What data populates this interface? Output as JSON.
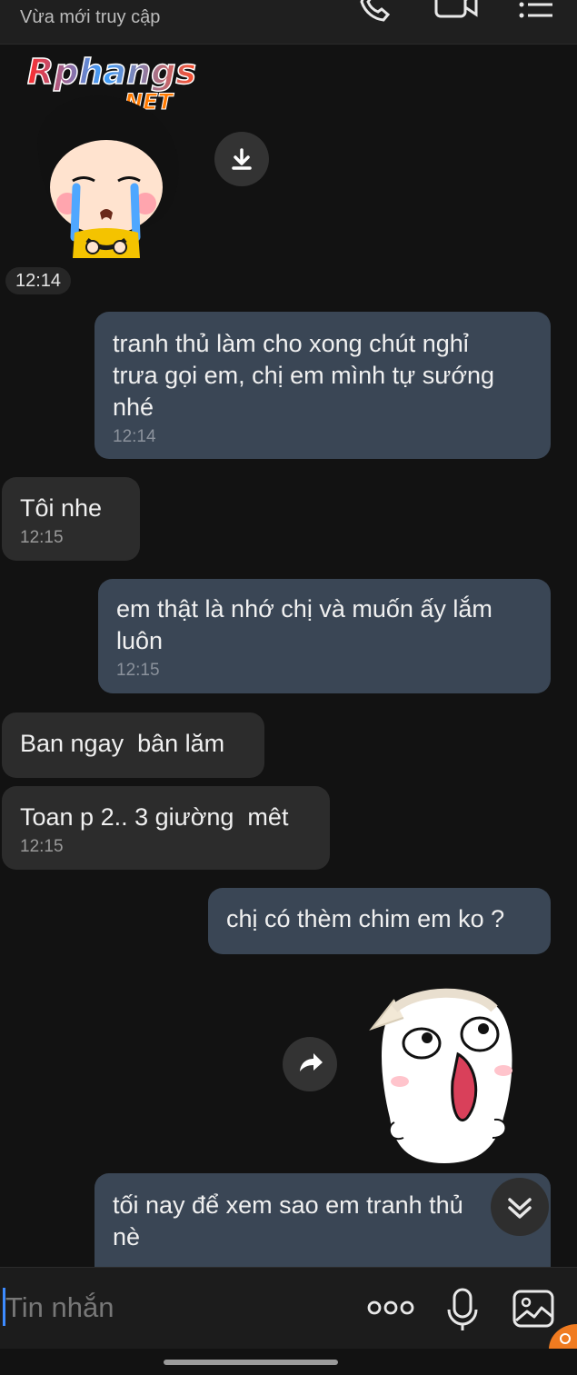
{
  "header": {
    "status": "Vừa mới truy cập",
    "icons": [
      "phone-icon",
      "video-call-icon",
      "menu-icon"
    ]
  },
  "watermark": {
    "text": "Rphangs",
    "suffix": ".NET"
  },
  "messages": [
    {
      "dir": "in",
      "type": "sticker",
      "sticker": "crying-girl"
    },
    {
      "dir": "chip",
      "text": "12:14"
    },
    {
      "dir": "out",
      "text": "tranh thủ làm cho xong chút nghỉ\ntrưa gọi em, chị em mình tự sướng\nnhé",
      "time": "12:14"
    },
    {
      "dir": "in",
      "text": "Tôi nhe",
      "time": "12:15"
    },
    {
      "dir": "out",
      "text": "em thật là nhớ chị và muốn ấy lắm\nluôn",
      "time": "12:15"
    },
    {
      "dir": "in",
      "text": "Ban ngay  bân lăm",
      "time": ""
    },
    {
      "dir": "in",
      "text": "Toan p 2.. 3 giường  mêt",
      "time": "12:15"
    },
    {
      "dir": "out",
      "text": "chị có thèm chim em ko ?",
      "time": ""
    },
    {
      "dir": "out",
      "type": "sticker",
      "sticker": "laughing-bun"
    },
    {
      "dir": "out",
      "text": "tối nay để xem sao em tranh thủ\nnè",
      "time": ""
    }
  ],
  "composer": {
    "placeholder": "Tin nhắn",
    "icons": [
      "more-icon",
      "microphone-icon",
      "image-icon"
    ]
  },
  "colors": {
    "background": "#121212",
    "outgoing": "#3a4655",
    "incoming": "#2c2c2c",
    "cursor": "#3d8bff",
    "accent": "#f07b20"
  }
}
